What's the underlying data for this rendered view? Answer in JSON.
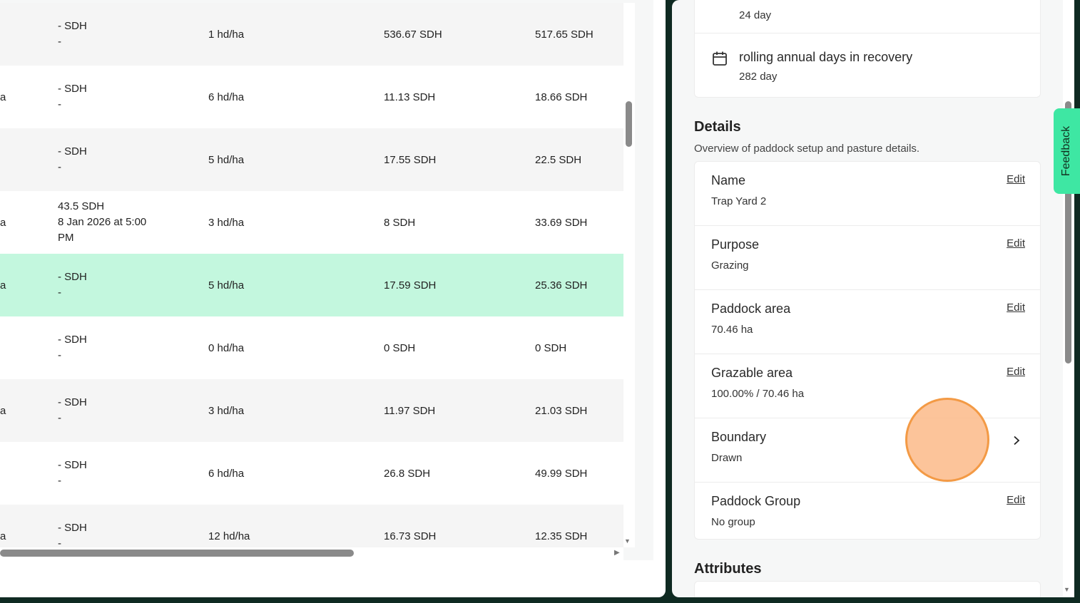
{
  "table": {
    "rows": [
      {
        "c0": "",
        "c1_line1": "- SDH",
        "c1_line2": "-",
        "c1_line3": "",
        "c2": "1 hd/ha",
        "c3": "536.67 SDH",
        "c4": "517.65 SDH",
        "highlighted": false
      },
      {
        "c0": "a",
        "c1_line1": "- SDH",
        "c1_line2": "-",
        "c1_line3": "",
        "c2": "6 hd/ha",
        "c3": "11.13 SDH",
        "c4": "18.66 SDH",
        "highlighted": false
      },
      {
        "c0": "",
        "c1_line1": "- SDH",
        "c1_line2": "-",
        "c1_line3": "",
        "c2": "5 hd/ha",
        "c3": "17.55 SDH",
        "c4": "22.5 SDH",
        "highlighted": false
      },
      {
        "c0": "a",
        "c1_line1": "43.5 SDH",
        "c1_line2": "8 Jan 2026 at 5:00",
        "c1_line3": "PM",
        "c2": "3 hd/ha",
        "c3": "8 SDH",
        "c4": "33.69 SDH",
        "highlighted": false
      },
      {
        "c0": "a",
        "c1_line1": "- SDH",
        "c1_line2": "-",
        "c1_line3": "",
        "c2": "5 hd/ha",
        "c3": "17.59 SDH",
        "c4": "25.36 SDH",
        "highlighted": true
      },
      {
        "c0": "",
        "c1_line1": "- SDH",
        "c1_line2": "-",
        "c1_line3": "",
        "c2": "0 hd/ha",
        "c3": "0 SDH",
        "c4": "0 SDH",
        "highlighted": false
      },
      {
        "c0": "a",
        "c1_line1": "- SDH",
        "c1_line2": "-",
        "c1_line3": "",
        "c2": "3 hd/ha",
        "c3": "11.97 SDH",
        "c4": "21.03 SDH",
        "highlighted": false
      },
      {
        "c0": "",
        "c1_line1": "- SDH",
        "c1_line2": "-",
        "c1_line3": "",
        "c2": "6 hd/ha",
        "c3": "26.8 SDH",
        "c4": "49.99 SDH",
        "highlighted": false
      },
      {
        "c0": "a",
        "c1_line1": "- SDH",
        "c1_line2": "-",
        "c1_line3": "",
        "c2": "12 hd/ha",
        "c3": "16.73 SDH",
        "c4": "12.35 SDH",
        "highlighted": false
      }
    ]
  },
  "stats": {
    "top_value": "24 day",
    "rolling_title": "rolling annual days in recovery",
    "rolling_value": "282 day",
    "icon": "calendar-icon"
  },
  "details": {
    "title": "Details",
    "subtitle": "Overview of paddock setup and pasture details.",
    "edit_label": "Edit",
    "rows": [
      {
        "label": "Name",
        "value": "Trap Yard 2",
        "action": "edit"
      },
      {
        "label": "Purpose",
        "value": "Grazing",
        "action": "edit"
      },
      {
        "label": "Paddock area",
        "value": "70.46 ha",
        "action": "edit"
      },
      {
        "label": "Grazable area",
        "value": "100.00% / 70.46 ha",
        "action": "edit"
      },
      {
        "label": "Boundary",
        "value": "Drawn",
        "action": "chevron"
      },
      {
        "label": "Paddock Group",
        "value": "No group",
        "action": "edit"
      }
    ]
  },
  "attributes": {
    "title": "Attributes"
  },
  "feedback": {
    "label": "Feedback"
  },
  "colors": {
    "highlight_row": "#c3f7de",
    "feedback_tab": "#3ee7a3",
    "cursor_fill": "#fcbe8f",
    "cursor_ring": "#f39a45",
    "frame": "#0f2a22"
  }
}
